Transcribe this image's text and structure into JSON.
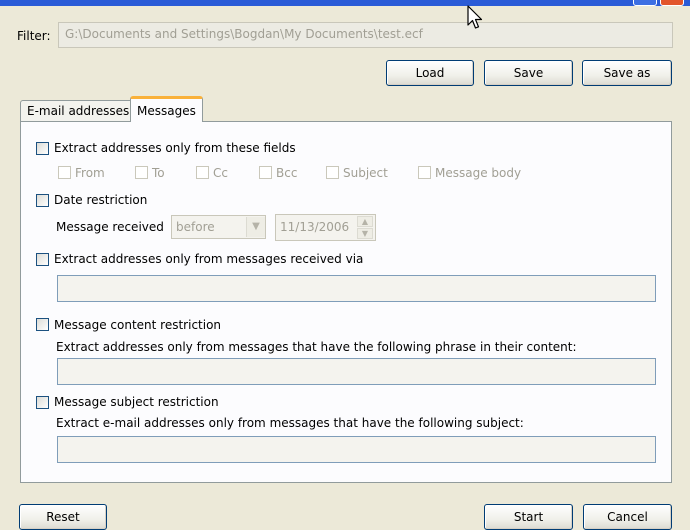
{
  "filter": {
    "label": "Filter:",
    "value": "G:\\Documents and Settings\\Bogdan\\My Documents\\test.ecf"
  },
  "toolbar": {
    "load": "Load",
    "save": "Save",
    "save_as": "Save as"
  },
  "tabs": [
    {
      "label": "E-mail addresses",
      "active": false
    },
    {
      "label": "Messages",
      "active": true
    }
  ],
  "messages": {
    "fields_restriction": {
      "label": "Extract addresses only from these fields",
      "options": [
        "From",
        "To",
        "Cc",
        "Bcc",
        "Subject",
        "Message body"
      ]
    },
    "date_restriction": {
      "label": "Date restriction",
      "received_label": "Message received",
      "comparison": "before",
      "date": "11/13/2006"
    },
    "via_restriction": {
      "label": "Extract addresses only from messages received via",
      "value": ""
    },
    "content_restriction": {
      "label": "Message content restriction",
      "description": "Extract addresses only from messages that have the following phrase in their content:",
      "value": ""
    },
    "subject_restriction": {
      "label": "Message subject restriction",
      "description": "Extract e-mail addresses only from messages that have the following subject:",
      "value": ""
    }
  },
  "footer": {
    "reset": "Reset",
    "start": "Start",
    "cancel": "Cancel"
  },
  "icons": {
    "dropdown": "chevron-down-icon",
    "spin_up": "spin-up-icon",
    "spin_down": "spin-down-icon",
    "cursor": "mouse-pointer-icon"
  },
  "colors": {
    "tab_accent": "#f9b13a",
    "button_border": "#003c74",
    "checkbox_border": "#1c5180",
    "window_bg": "#ece9d8"
  }
}
